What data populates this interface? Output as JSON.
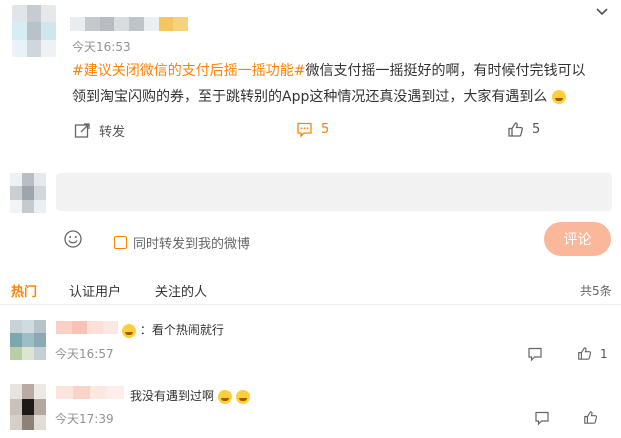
{
  "post": {
    "time": "今天16:53",
    "hashtag": "#建议关闭微信的支付后摇一摇功能#",
    "body": "微信支付摇一摇挺好的啊，有时候付完钱可以领到淘宝闪购的券，至于跳转别的App这种情况还真没遇到过，大家有遇到么",
    "actions": {
      "repost_label": "转发",
      "comment_count": "5",
      "like_count": "5"
    }
  },
  "composer": {
    "input_placeholder": "",
    "repost_checkbox_label": "同时转发到我的微博",
    "submit_label": "评论"
  },
  "comments_tabs": {
    "hot": "热门",
    "verified": "认证用户",
    "following": "关注的人",
    "total": "共5条"
  },
  "comments": [
    {
      "text": "：看个热闹就行",
      "time": "今天16:57",
      "like_count": "1"
    },
    {
      "text": "我没有遇到过啊",
      "time": "今天17:39",
      "like_count": ""
    }
  ],
  "colors": {
    "accent": "#ff8200",
    "button": "#fbb79a",
    "input_bg": "#f2f2f2"
  },
  "icons": [
    "chevron-down-icon",
    "repost-icon",
    "comment-icon",
    "like-icon",
    "emoji-icon",
    "reply-icon"
  ]
}
